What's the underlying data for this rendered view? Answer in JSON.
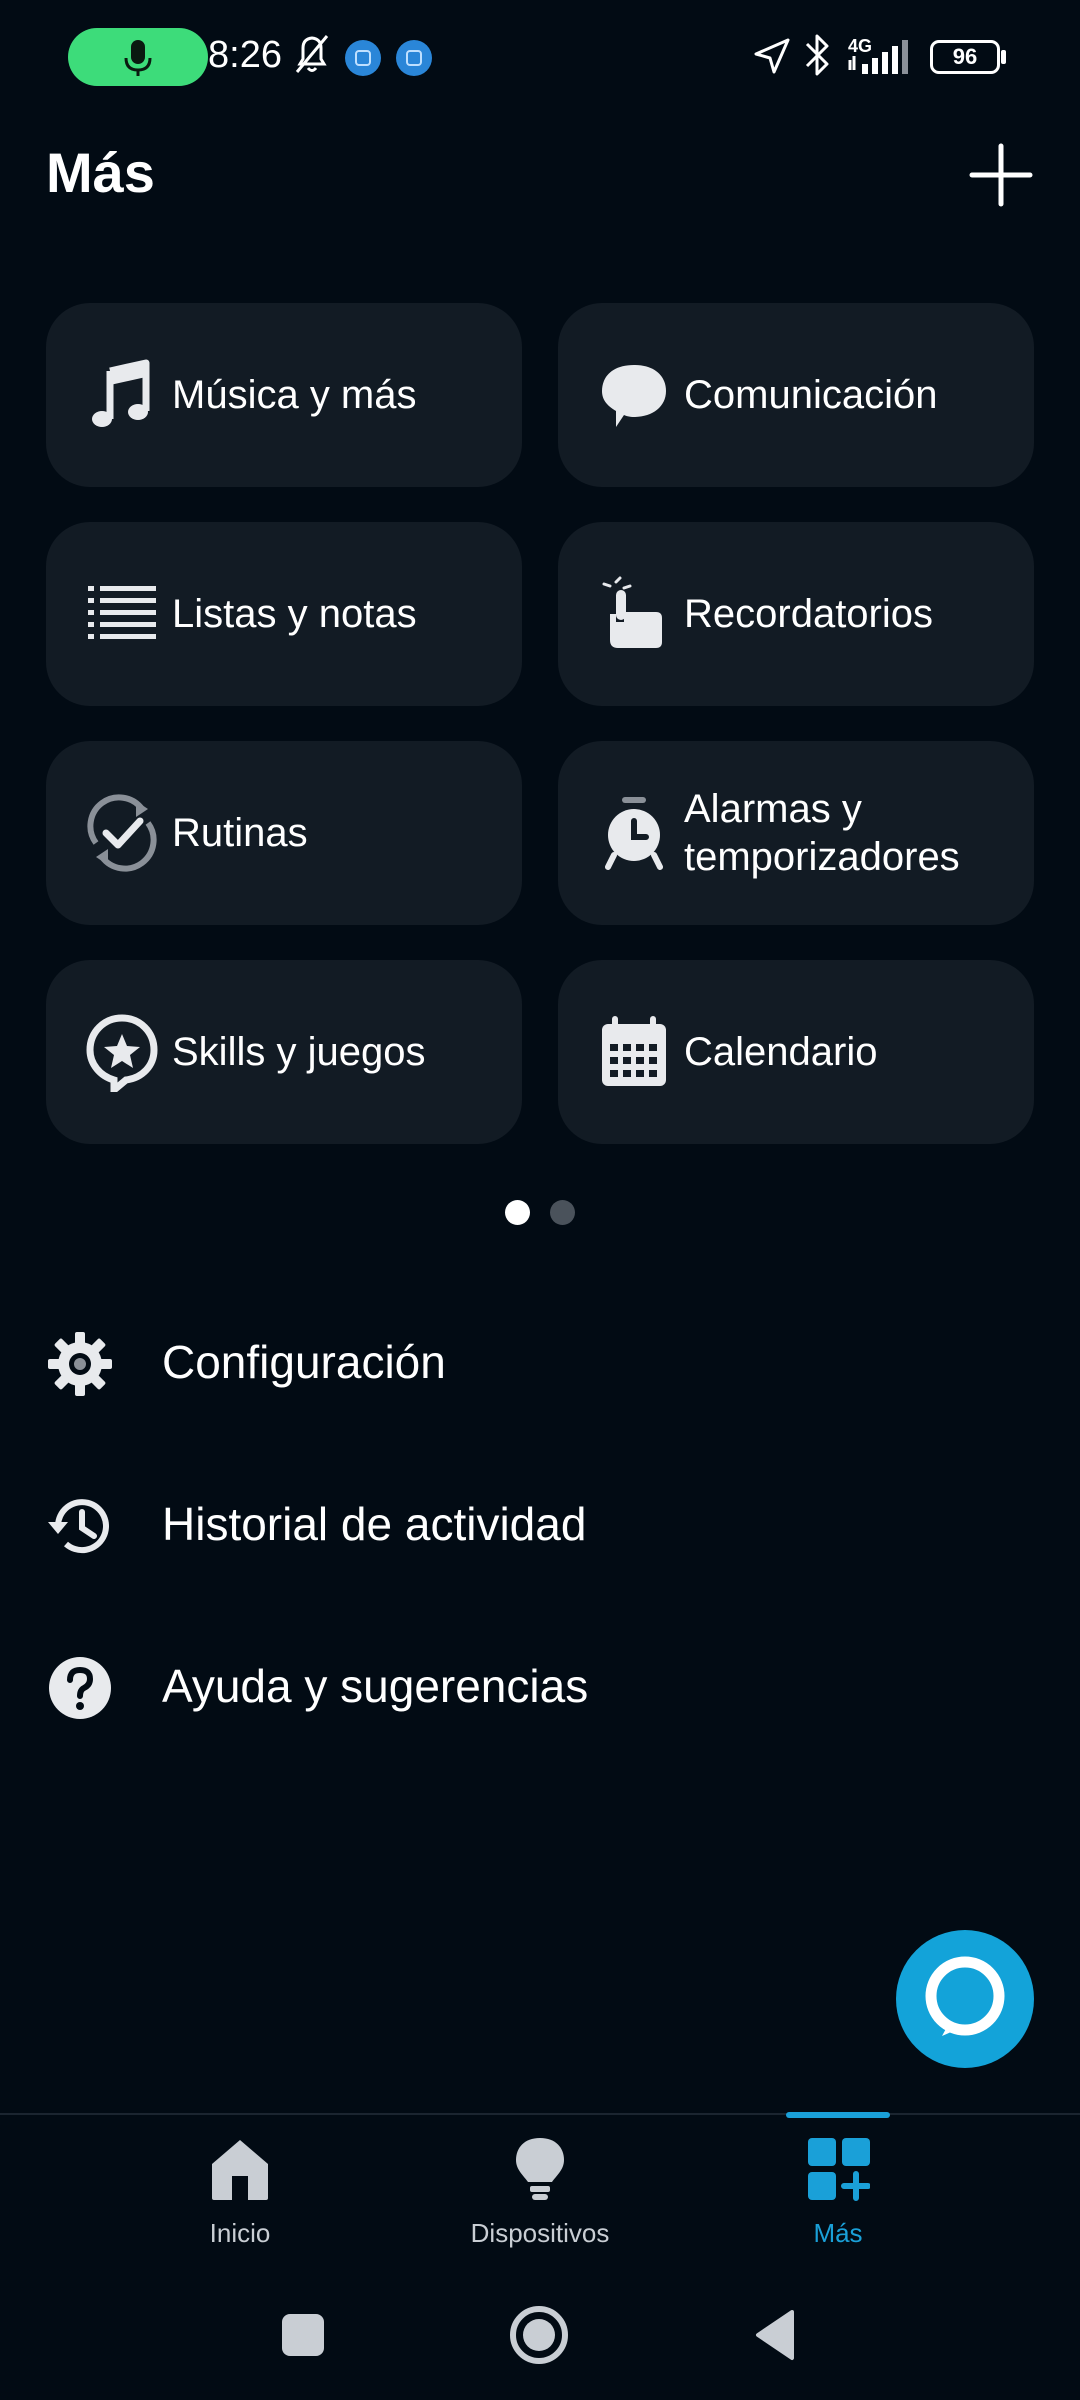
{
  "status_bar": {
    "time": "8:26",
    "network": "4G",
    "battery": "96",
    "icons": [
      "mic-icon",
      "bell-off-icon",
      "app-notification-icon",
      "app-notification-icon",
      "location-arrow-icon",
      "bluetooth-icon",
      "signal-icon",
      "battery-icon"
    ]
  },
  "header": {
    "title": "Más",
    "add_icon": "plus-icon"
  },
  "tiles": [
    {
      "label": "Música y más",
      "icon": "music-note-icon"
    },
    {
      "label": "Comunicación",
      "icon": "chat-bubble-icon"
    },
    {
      "label": "Listas y notas",
      "icon": "list-icon"
    },
    {
      "label": "Recordatorios",
      "icon": "reminder-hand-icon"
    },
    {
      "label": "Rutinas",
      "icon": "routine-refresh-icon"
    },
    {
      "label": "Alarmas y temporizadores",
      "icon": "alarm-clock-icon"
    },
    {
      "label": "Skills y juegos",
      "icon": "skills-star-icon"
    },
    {
      "label": "Calendario",
      "icon": "calendar-icon"
    }
  ],
  "pager": {
    "pages": 2,
    "current": 1
  },
  "list": [
    {
      "label": "Configuración",
      "icon": "gear-icon"
    },
    {
      "label": "Historial de actividad",
      "icon": "history-icon"
    },
    {
      "label": "Ayuda y sugerencias",
      "icon": "help-icon"
    }
  ],
  "fab": {
    "icon": "alexa-icon"
  },
  "bottom_nav": [
    {
      "label": "Inicio",
      "icon": "home-icon",
      "active": false
    },
    {
      "label": "Dispositivos",
      "icon": "lightbulb-icon",
      "active": false
    },
    {
      "label": "Más",
      "icon": "grid-plus-icon",
      "active": true
    }
  ],
  "colors": {
    "background": "#020b14",
    "tile": "#121b24",
    "accent": "#1aa0d8",
    "mic_pill": "#3ddc7a"
  }
}
